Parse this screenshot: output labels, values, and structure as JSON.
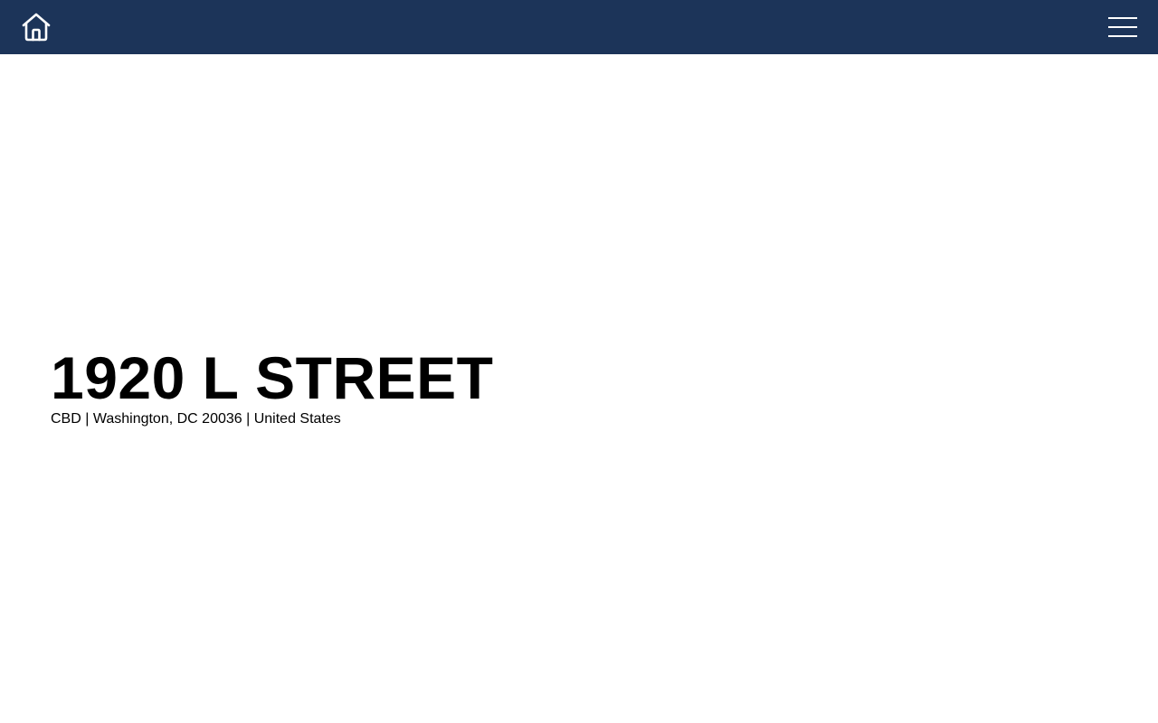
{
  "header": {
    "home_icon": "home-icon",
    "menu_icon": "hamburger-menu-icon",
    "background_color": "#1c3459",
    "icon_color": "#ffffff"
  },
  "hero": {
    "title": "1920 L STREET",
    "address": "CBD | Washington, DC 20036 | United States"
  }
}
